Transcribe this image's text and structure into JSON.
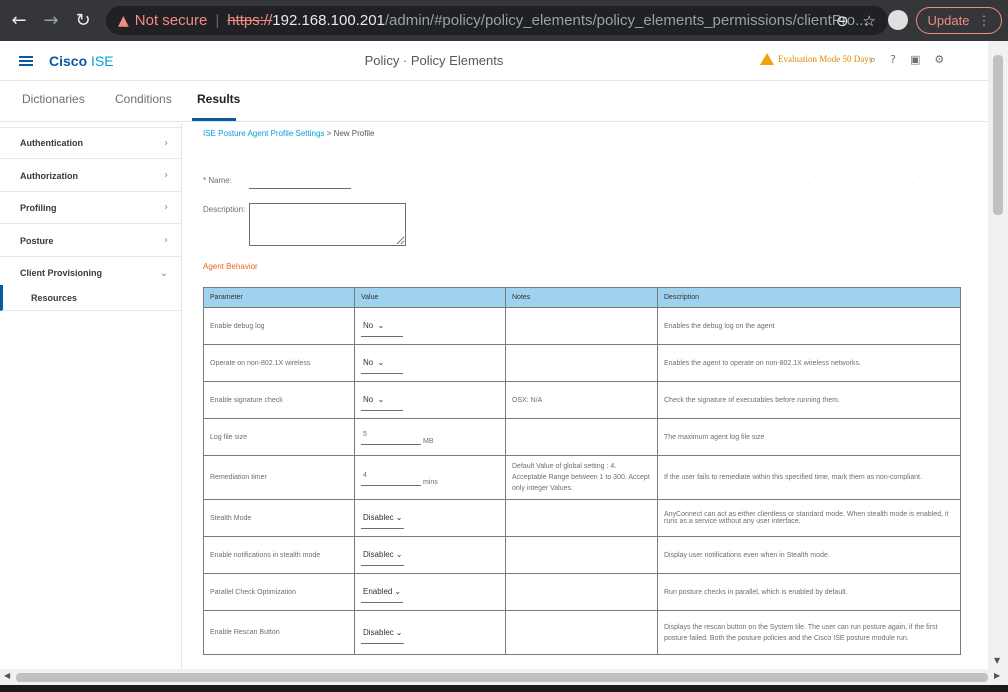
{
  "browser": {
    "not_secure": "Not secure",
    "url_scheme": "https://",
    "url_host": "192.168.100.201",
    "url_path": "/admin/#policy/policy_elements/policy_elements_permissions/clientPro...",
    "update_label": "Update"
  },
  "header": {
    "brand_main": "Cisco",
    "brand_sub": "ISE",
    "title": "Policy · Policy Elements",
    "eval_mode": "Evaluation Mode 50 Days"
  },
  "tabs": [
    {
      "label": "Dictionaries"
    },
    {
      "label": "Conditions"
    },
    {
      "label": "Results"
    }
  ],
  "sidebar": {
    "items": [
      {
        "label": "Authentication"
      },
      {
        "label": "Authorization"
      },
      {
        "label": "Profiling"
      },
      {
        "label": "Posture"
      },
      {
        "label": "Client Provisioning"
      }
    ],
    "sub_item": "Resources"
  },
  "breadcrumb": {
    "link": "ISE Posture Agent Profile Settings",
    "sep": ">",
    "current": "New Profile"
  },
  "form": {
    "name_label": "* Name:",
    "name_value": "",
    "description_label": "Description:",
    "description_value": "",
    "section_title": "Agent Behavior"
  },
  "table": {
    "headers": [
      "Parameter",
      "Value",
      "Notes",
      "Description"
    ],
    "rows": [
      {
        "param": "Enable debug log",
        "value": "No",
        "notes": "",
        "desc": "Enables the debug log on the agent"
      },
      {
        "param": "Operate on non-802.1X wireless",
        "value": "No",
        "notes": "",
        "desc": "Enables the agent to operate on non-802.1X wireless networks."
      },
      {
        "param": "Enable signature check",
        "value": "No",
        "notes": "OSX: N/A",
        "desc": "Check the signature of executables before running them."
      },
      {
        "param": "Log file size",
        "value": "5",
        "unit": "MB",
        "notes": "",
        "desc": "The maximum agent log file size"
      },
      {
        "param": "Remediation timer",
        "value": "4",
        "unit": "mins",
        "notes": "Default Value of global setting : 4. Acceptable Range between 1 to 300. Accept only integer Values.",
        "desc": "If the user fails to remediate within this specified time, mark them as non-compliant."
      },
      {
        "param": "Stealth Mode",
        "value": "Disablec",
        "notes": "",
        "desc": "AnyConnect can act as either clientless or standard mode. When stealth mode is enabled, it runs as a service without any user interface."
      },
      {
        "param": "Enable notifications in stealth mode",
        "value": "Disablec",
        "notes": "",
        "desc": "Display user notifications even when in Stealth mode."
      },
      {
        "param": "Parallel Check Optimization",
        "value": "Enabled",
        "notes": "",
        "desc": "Run posture checks in parallel, which is enabled by default."
      },
      {
        "param": "Enable Rescan Button",
        "value": "Disablec",
        "notes": "",
        "desc": "Displays the rescan button on the System tile. The user can run posture again, if the first posture failed. Both the posture policies and the Cisco ISE posture module run."
      }
    ]
  },
  "colors": {
    "cisco_blue": "#0b59a3",
    "header_cell": "#9fd2ee",
    "section_orange": "#f0641e",
    "browser_warning": "#f28b82"
  }
}
